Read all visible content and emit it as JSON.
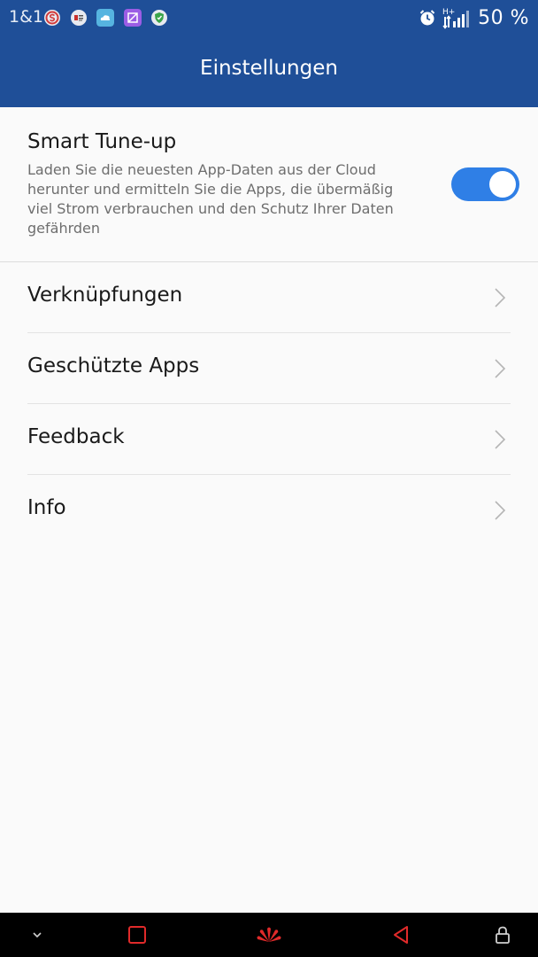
{
  "status_bar": {
    "carrier": "1&1",
    "battery_percent": "50 %",
    "notification_icons": [
      "s-app-icon",
      "news-app-icon",
      "cloud-app-icon",
      "gallery-app-icon",
      "shield-app-icon"
    ],
    "signal_type": "H+",
    "alarm_icon": "alarm-clock-icon"
  },
  "header": {
    "title": "Einstellungen",
    "background_color": "#1f4f98"
  },
  "smart_tuneup": {
    "title": "Smart Tune-up",
    "description": "Laden Sie die neuesten App-Daten aus der Cloud herunter und ermitteln Sie die Apps, die übermäßig viel Strom verbrauchen und den Schutz Ihrer Daten gefährden",
    "enabled": true,
    "toggle_color": "#2f7fe6"
  },
  "menu": {
    "items": [
      {
        "label": "Verknüpfungen"
      },
      {
        "label": "Geschützte Apps"
      },
      {
        "label": "Feedback"
      },
      {
        "label": "Info"
      }
    ]
  },
  "nav_bar": {
    "buttons": [
      "expand-down-icon",
      "recent-apps-icon",
      "huawei-logo",
      "back-icon",
      "lock-icon"
    ]
  }
}
